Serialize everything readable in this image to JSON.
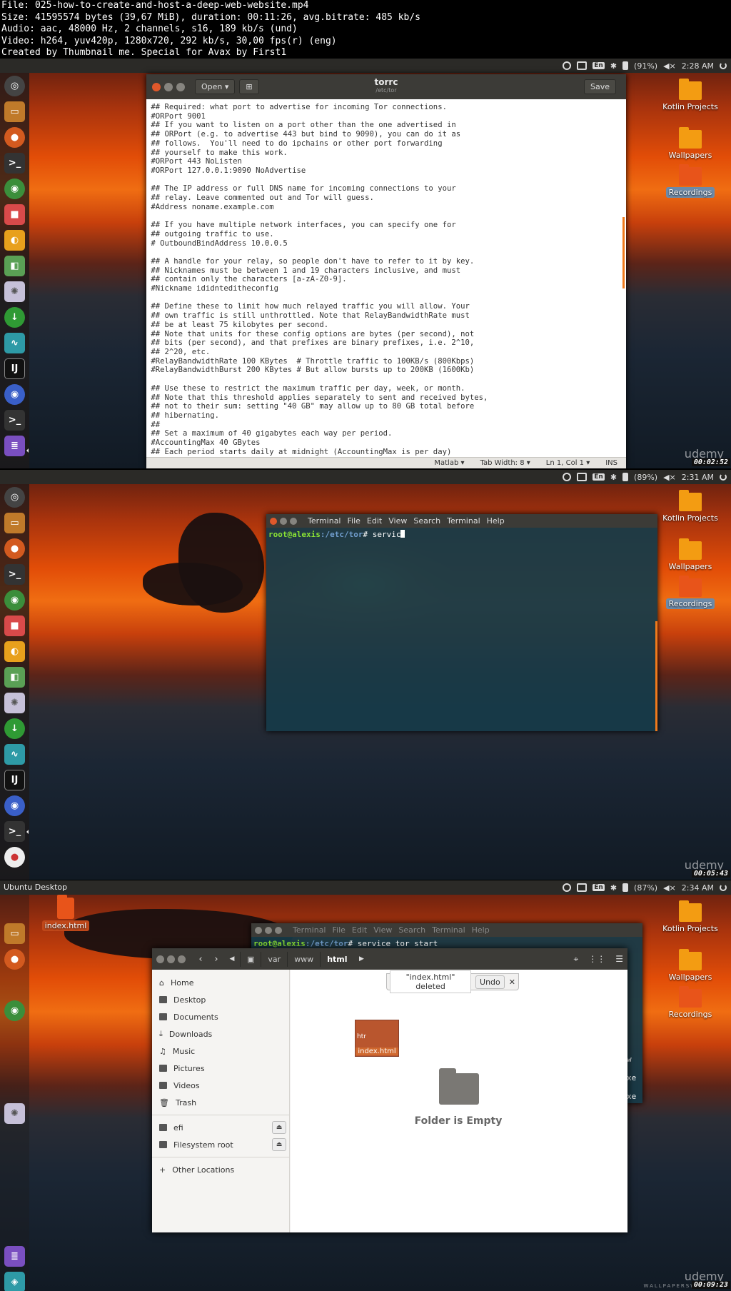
{
  "info": {
    "lines": [
      "File: 025-how-to-create-and-host-a-deep-web-website.mp4",
      "Size: 41595574 bytes (39,67 MiB), duration: 00:11:26, avg.bitrate: 485 kb/s",
      "Audio: aac, 48000 Hz, 2 channels, s16, 189 kb/s (und)",
      "Video: h264, yuv420p, 1280x720, 292 kb/s, 30,00 fps(r) (eng)",
      "Created by Thumbnail me. Special for Avax by First1"
    ]
  },
  "frame1": {
    "battery": "(91%)",
    "time": "2:28 AM",
    "lang": "En",
    "timecode": "00:02:52",
    "desktop_icons": [
      "Kotlin Projects",
      "Wallpapers",
      "Recordings"
    ],
    "gedit": {
      "open_label": "Open",
      "title": "torrc",
      "subtitle": "/etc/tor",
      "save_label": "Save",
      "lines": [
        "## Required: what port to advertise for incoming Tor connections.",
        "#ORPort 9001",
        "## If you want to listen on a port other than the one advertised in",
        "## ORPort (e.g. to advertise 443 but bind to 9090), you can do it as",
        "## follows.  You'll need to do ipchains or other port forwarding",
        "## yourself to make this work.",
        "#ORPort 443 NoListen",
        "#ORPort 127.0.0.1:9090 NoAdvertise",
        "",
        "## The IP address or full DNS name for incoming connections to your",
        "## relay. Leave commented out and Tor will guess.",
        "#Address noname.example.com",
        "",
        "## If you have multiple network interfaces, you can specify one for",
        "## outgoing traffic to use.",
        "# OutboundBindAddress 10.0.0.5",
        "",
        "## A handle for your relay, so people don't have to refer to it by key.",
        "## Nicknames must be between 1 and 19 characters inclusive, and must",
        "## contain only the characters [a-zA-Z0-9].",
        "#Nickname ididnteditheconfig",
        "",
        "## Define these to limit how much relayed traffic you will allow. Your",
        "## own traffic is still unthrottled. Note that RelayBandwidthRate must",
        "## be at least 75 kilobytes per second.",
        "## Note that units for these config options are bytes (per second), not",
        "## bits (per second), and that prefixes are binary prefixes, i.e. 2^10,",
        "## 2^20, etc.",
        "#RelayBandwidthRate 100 KBytes  # Throttle traffic to 100KB/s (800Kbps)",
        "#RelayBandwidthBurst 200 KBytes # But allow bursts up to 200KB (1600Kb)",
        "",
        "## Use these to restrict the maximum traffic per day, week, or month.",
        "## Note that this threshold applies separately to sent and received bytes,",
        "## not to their sum: setting \"40 GB\" may allow up to 80 GB total before",
        "## hibernating.",
        "##",
        "## Set a maximum of 40 gigabytes each way per period.",
        "#AccountingMax 40 GBytes",
        "## Each period starts daily at midnight (AccountingMax is per day)"
      ],
      "status": {
        "lang": "Matlab",
        "tab": "Tab Width: 8",
        "pos": "Ln 1, Col 1",
        "mode": "INS"
      }
    }
  },
  "frame2": {
    "battery": "(89%)",
    "time": "2:31 AM",
    "lang": "En",
    "timecode": "00:05:43",
    "desktop_icons": [
      "Kotlin Projects",
      "Wallpapers",
      "Recordings"
    ],
    "terminal": {
      "menu": [
        "Terminal",
        "File",
        "Edit",
        "View",
        "Search",
        "Terminal",
        "Help"
      ],
      "user": "root@alexis",
      "path": ":/etc/tor",
      "command": "# servic"
    }
  },
  "frame3": {
    "top_title": "Ubuntu Desktop",
    "battery": "(87%)",
    "time": "2:34 AM",
    "lang": "En",
    "timecode": "00:09:23",
    "desktop_file": "index.html",
    "desktop_icons": [
      "Kotlin Projects",
      "Wallpapers",
      "Recordings"
    ],
    "terminal": {
      "menu": [
        "Terminal",
        "File",
        "Edit",
        "View",
        "Search",
        "Terminal",
        "Help"
      ],
      "user": "root@alexis",
      "path": ":/etc/tor",
      "command": "# service tor start",
      "side_chars": [
        "w",
        "xe",
        "xe"
      ]
    },
    "nautilus": {
      "breadcrumbs": [
        "var",
        "www",
        "html"
      ],
      "sidebar": [
        "Home",
        "Desktop",
        "Documents",
        "Downloads",
        "Music",
        "Pictures",
        "Videos",
        "Trash"
      ],
      "devices": [
        "efi",
        "Filesystem root"
      ],
      "other": "Other Locations",
      "toast": "\"index.html\" deleted",
      "undo": "Undo",
      "file_label": "index.html",
      "file_tag": "htr",
      "empty": "Folder is Empty"
    }
  },
  "brand": "udemy",
  "watermark": "WALLPAPERSWIDE"
}
